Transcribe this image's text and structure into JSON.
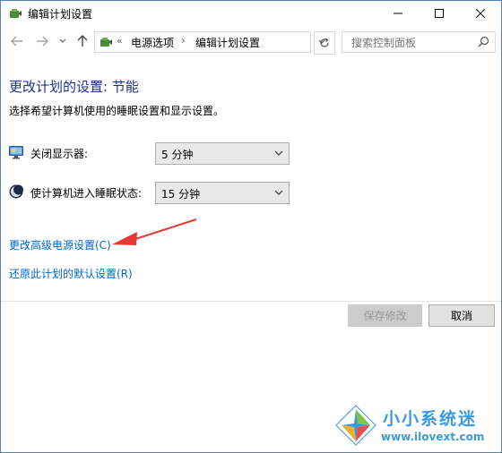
{
  "window": {
    "title": "编辑计划设置",
    "controls": {
      "minimize": "minimize",
      "maximize": "maximize",
      "close": "close"
    }
  },
  "navbar": {
    "back_icon": "back-arrow-icon",
    "forward_icon": "forward-arrow-icon",
    "up_icon": "up-arrow-icon",
    "overflow": "«",
    "breadcrumb": [
      "电源选项",
      "编辑计划设置"
    ],
    "breadcrumb_separator": "›",
    "refresh_icon": "refresh-icon",
    "search_placeholder": "搜索控制面板"
  },
  "main": {
    "heading": "更改计划的设置: 节能",
    "description": "选择希望计算机使用的睡眠设置和显示设置。",
    "settings": [
      {
        "label": "关闭显示器:",
        "value": "5 分钟",
        "icon": "monitor-icon"
      },
      {
        "label": "使计算机进入睡眠状态:",
        "value": "15 分钟",
        "icon": "moon-icon"
      }
    ],
    "links": {
      "advanced": "更改高级电源设置(C)",
      "restore": "还原此计划的默认设置(R)"
    }
  },
  "footer": {
    "save_label": "保存修改",
    "cancel_label": "取消"
  },
  "watermark": {
    "name": "小小系统迷",
    "url": "www.ilovext.com"
  },
  "colors": {
    "heading": "#1e3287",
    "link": "#0066cc",
    "annotation_arrow": "#e53935",
    "watermark": "#3a9ae0"
  }
}
